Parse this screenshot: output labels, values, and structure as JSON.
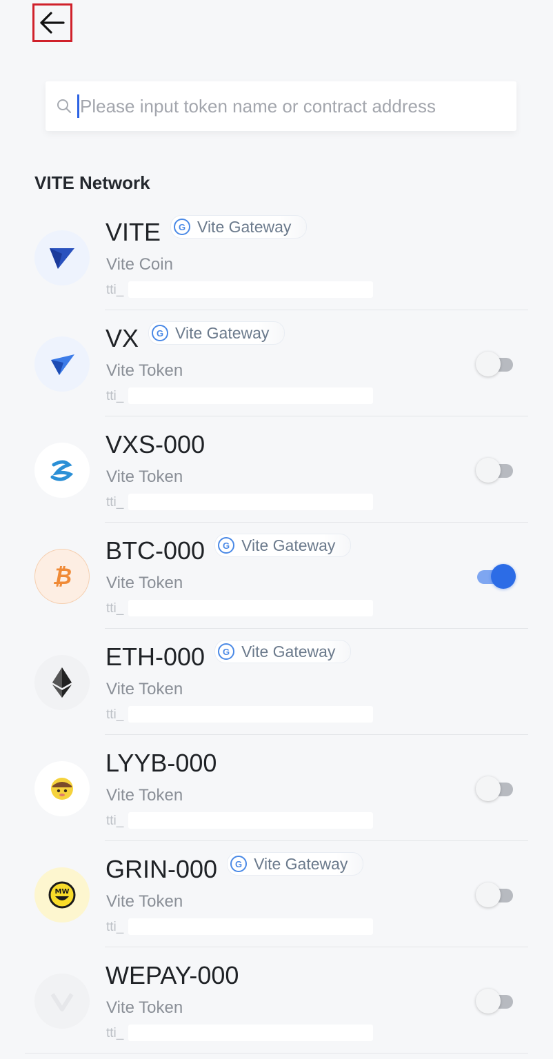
{
  "header": {
    "back_icon": "arrow-left-icon"
  },
  "search": {
    "placeholder": "Please input token name or contract address",
    "value": "",
    "icon": "search-icon"
  },
  "section": {
    "title": "VITE Network"
  },
  "gateway_label": "Vite Gateway",
  "tokens": [
    {
      "symbol": "VITE",
      "name": "Vite Coin",
      "id_prefix": "tti_",
      "gateway": true,
      "toggle": null,
      "icon": "vite-logo-icon"
    },
    {
      "symbol": "VX",
      "name": "Vite Token",
      "id_prefix": "tti_",
      "gateway": true,
      "toggle": "off",
      "icon": "vx-logo-icon"
    },
    {
      "symbol": "VXS-000",
      "name": "Vite Token",
      "id_prefix": "tti_",
      "gateway": false,
      "toggle": "off",
      "icon": "vxs-logo-icon"
    },
    {
      "symbol": "BTC-000",
      "name": "Vite Token",
      "id_prefix": "tti_",
      "gateway": true,
      "toggle": "on",
      "icon": "bitcoin-logo-icon"
    },
    {
      "symbol": "ETH-000",
      "name": "Vite Token",
      "id_prefix": "tti_",
      "gateway": true,
      "toggle": null,
      "icon": "ethereum-logo-icon"
    },
    {
      "symbol": "LYYB-000",
      "name": "Vite Token",
      "id_prefix": "tti_",
      "gateway": false,
      "toggle": "off",
      "icon": "lyyb-logo-icon"
    },
    {
      "symbol": "GRIN-000",
      "name": "Vite Token",
      "id_prefix": "tti_",
      "gateway": true,
      "toggle": "off",
      "icon": "grin-logo-icon"
    },
    {
      "symbol": "WEPAY-000",
      "name": "Vite Token",
      "id_prefix": "tti_",
      "gateway": false,
      "toggle": "off",
      "icon": "wepay-logo-icon"
    }
  ],
  "colors": {
    "accent": "#2c6ce6",
    "back_highlight": "#d0212b",
    "background": "#f6f7f9"
  }
}
